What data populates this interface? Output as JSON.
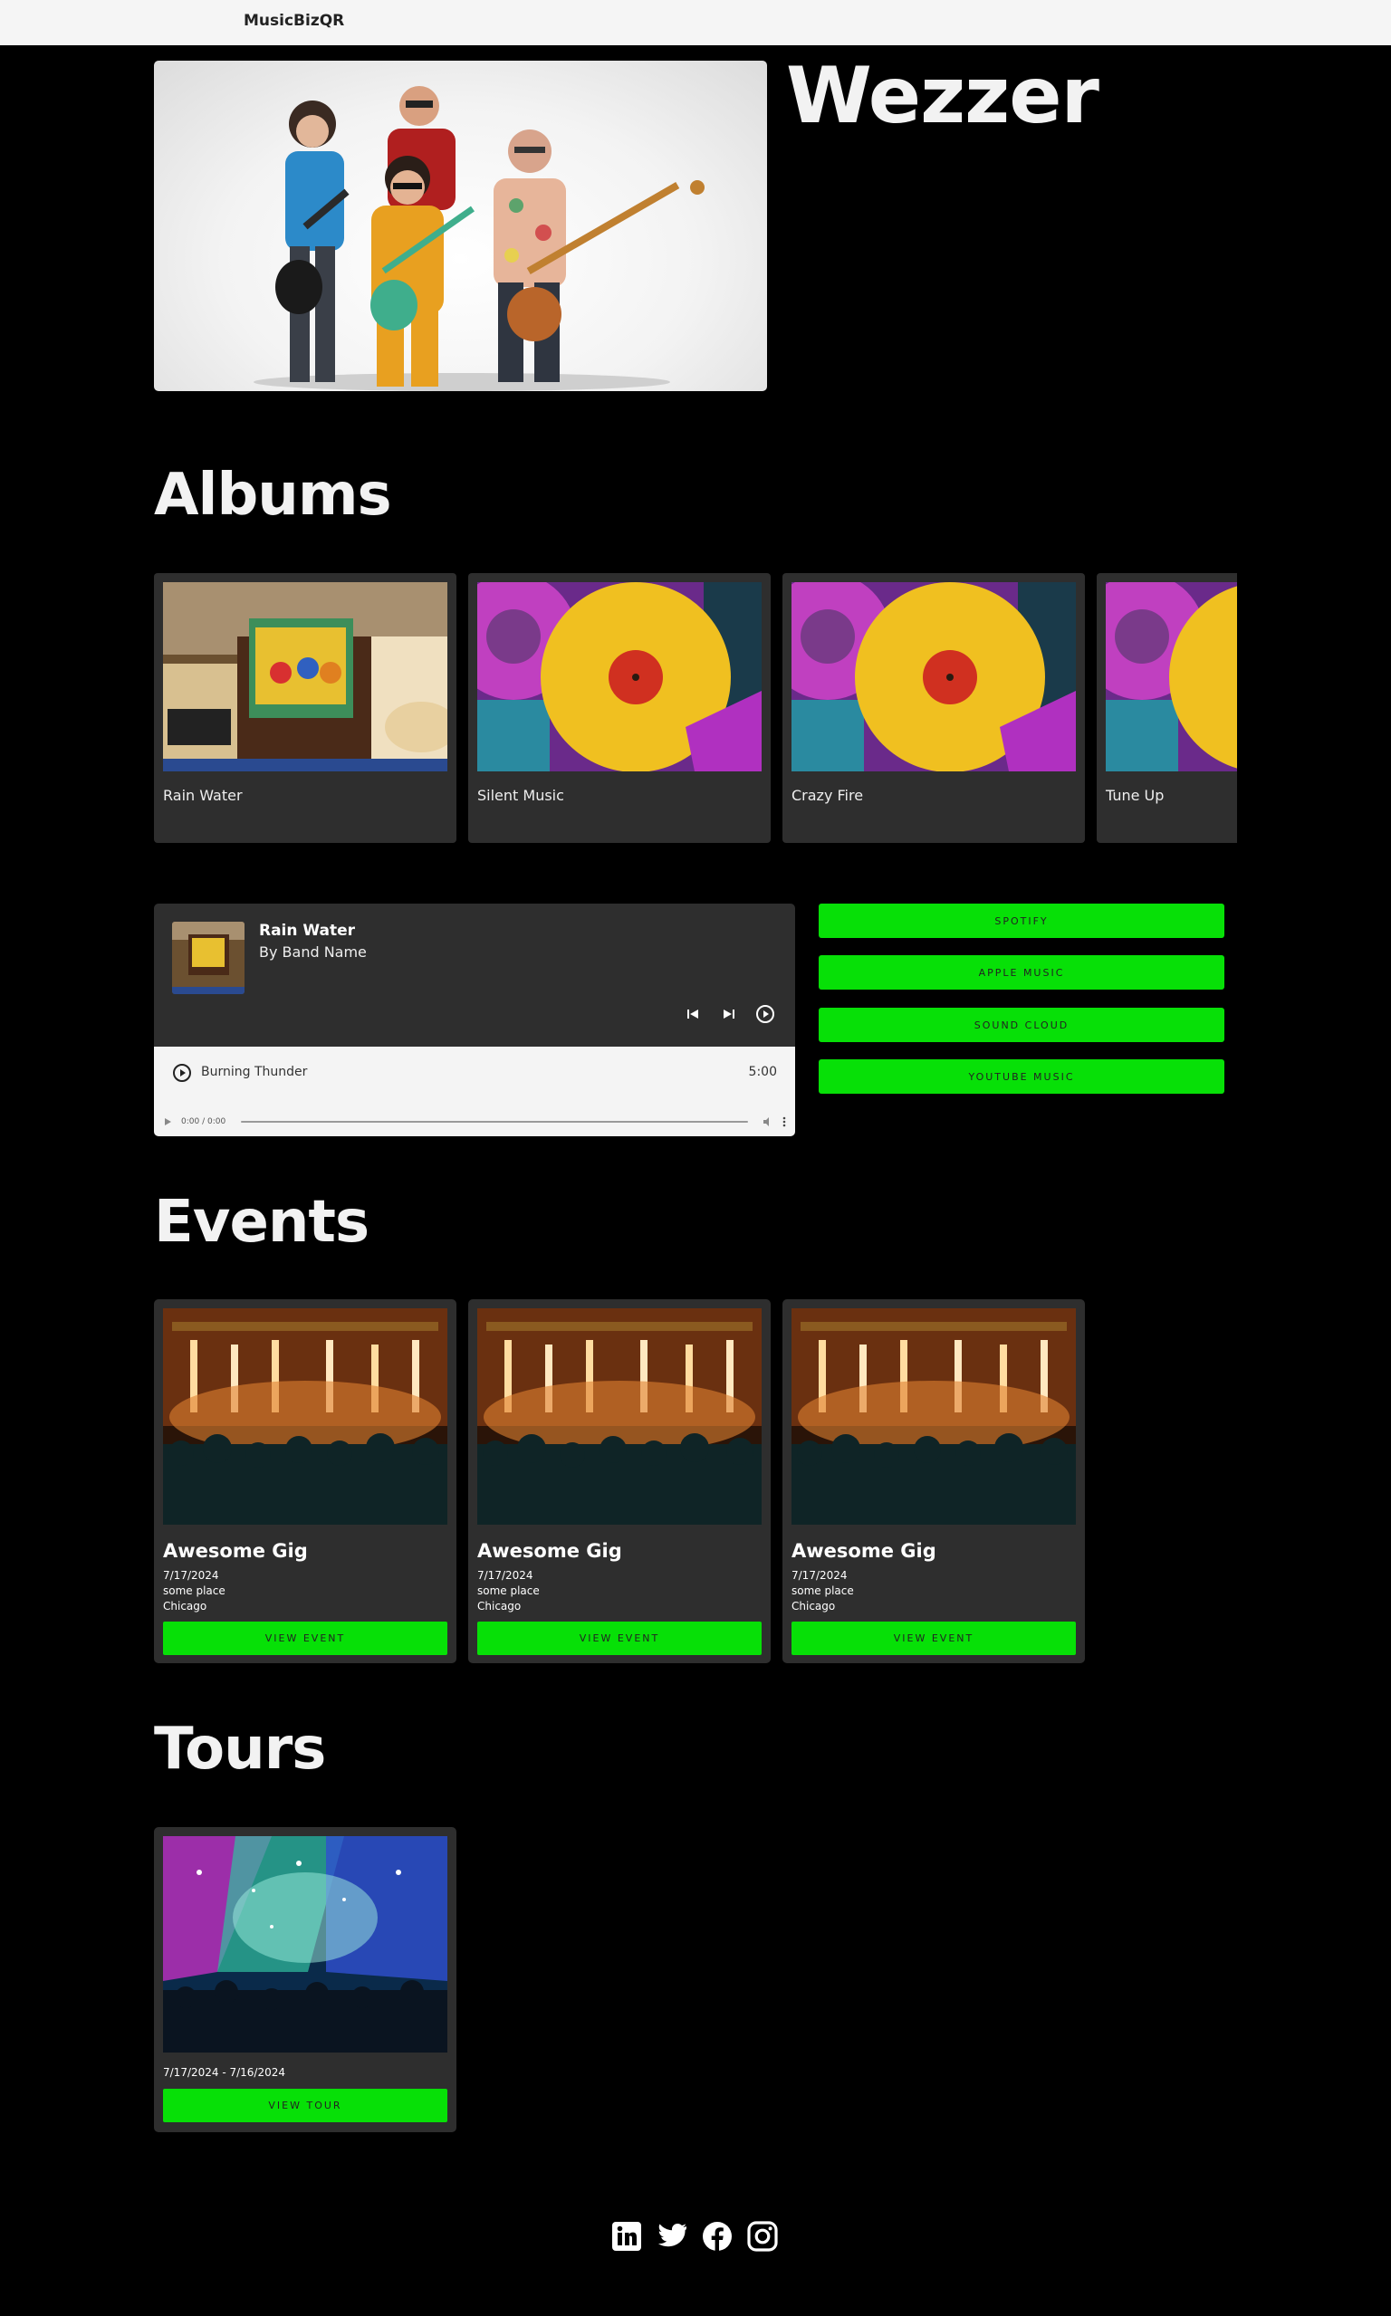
{
  "header": {
    "brand": "MusicBizQR"
  },
  "band": {
    "name": "Wezzer"
  },
  "sections": {
    "albums": "Albums",
    "events": "Events",
    "tours": "Tours"
  },
  "albums": [
    {
      "name": "Rain Water"
    },
    {
      "name": "Silent Music"
    },
    {
      "name": "Crazy Fire"
    },
    {
      "name": "Tune Up"
    }
  ],
  "player": {
    "title": "Rain Water",
    "artist": "By Band Name",
    "track": {
      "name": "Burning Thunder",
      "duration": "5:00"
    },
    "audio_time": "0:00 / 0:00",
    "controls": [
      "previous-icon",
      "next-icon",
      "play-circle-icon"
    ]
  },
  "streaming": [
    {
      "label": "SPOTIFY"
    },
    {
      "label": "APPLE MUSIC"
    },
    {
      "label": "SOUND CLOUD"
    },
    {
      "label": "YOUTUBE MUSIC"
    }
  ],
  "events": [
    {
      "title": "Awesome Gig",
      "date": "7/17/2024",
      "venue": "some place",
      "city": "Chicago",
      "button": "VIEW EVENT"
    },
    {
      "title": "Awesome Gig",
      "date": "7/17/2024",
      "venue": "some place",
      "city": "Chicago",
      "button": "VIEW EVENT"
    },
    {
      "title": "Awesome Gig",
      "date": "7/17/2024",
      "venue": "some place",
      "city": "Chicago",
      "button": "VIEW EVENT"
    }
  ],
  "tours": [
    {
      "dates": "7/17/2024 - 7/16/2024",
      "button": "VIEW TOUR"
    }
  ],
  "socials": [
    "linkedin-icon",
    "twitter-icon",
    "facebook-icon",
    "instagram-icon"
  ],
  "colors": {
    "accent": "#07e007",
    "card": "#2e2e2e",
    "background": "#000000"
  }
}
